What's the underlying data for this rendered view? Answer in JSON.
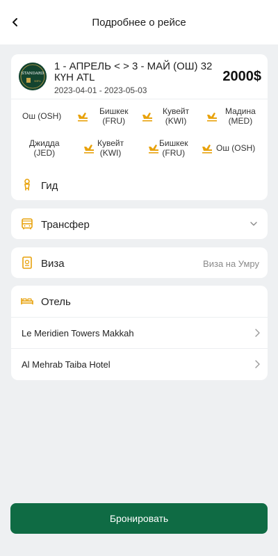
{
  "header": {
    "title": "Подробнее о рейсе"
  },
  "trip": {
    "logo_text": "STANDARD",
    "logo_subtext": "УМРА",
    "title": "1 - АПРЕЛЬ < > 3 -  МАЙ (ОШ) 32 КҮН ATL",
    "dates": "2023-04-01 - 2023-05-03",
    "price": "2000$",
    "route1": [
      {
        "name": "Ош (OSH)"
      },
      {
        "name": "Бишкек\n(FRU)"
      },
      {
        "name": "Кувейт\n(KWI)"
      },
      {
        "name": "Мадина\n(MED)"
      }
    ],
    "route2": [
      {
        "name": "Джидда\n(JED)"
      },
      {
        "name": "Кувейт\n(KWI)"
      },
      {
        "name": "Бишкек\n(FRU)"
      },
      {
        "name": "Ош (OSH)"
      }
    ]
  },
  "rows": {
    "guide": {
      "label": "Гид"
    },
    "transfer": {
      "label": "Трансфер"
    },
    "visa": {
      "label": "Виза",
      "value": "Виза на Умру"
    }
  },
  "hotel": {
    "label": "Отель",
    "items": [
      {
        "name": "Le Meridien Towers Makkah"
      },
      {
        "name": "Al Mehrab Taiba Hotel"
      }
    ]
  },
  "book_button": {
    "label": "Бронировать"
  },
  "colors": {
    "accent": "#e8a20c",
    "primary": "#0f6b44",
    "background": "#eef0f2"
  },
  "icons": {
    "back": "chevron-left-icon",
    "plane": "airplane-landing-icon",
    "guide": "person-icon",
    "transfer": "bus-icon",
    "visa": "passport-icon",
    "hotel": "bed-icon",
    "chevron_down": "chevron-down-icon",
    "chevron_right": "chevron-right-icon"
  }
}
